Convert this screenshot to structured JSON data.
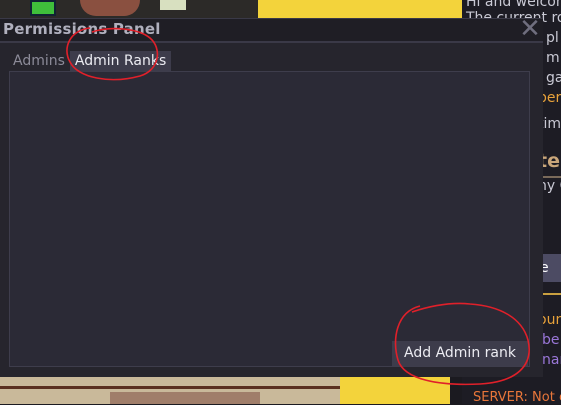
{
  "window": {
    "title": "Permissions Panel",
    "close_glyph": "✕",
    "tabs": [
      {
        "label": "Admins",
        "active": false
      },
      {
        "label": "Admin Ranks",
        "active": true
      }
    ],
    "add_button_label": "Add Admin rank"
  },
  "chat": {
    "lines": [
      "Hi and welcom",
      "The current ro",
      "t pl",
      "t m",
      "t ga",
      "per",
      "tim"
    ],
    "heading": "ter",
    "subline": "ny C",
    "tab_label": "e",
    "orange_line": "oun",
    "purple_line_1": "be",
    "purple_line_2": "nar",
    "server_line": "SERVER: Not c"
  },
  "annotation_color": "#e0202a"
}
